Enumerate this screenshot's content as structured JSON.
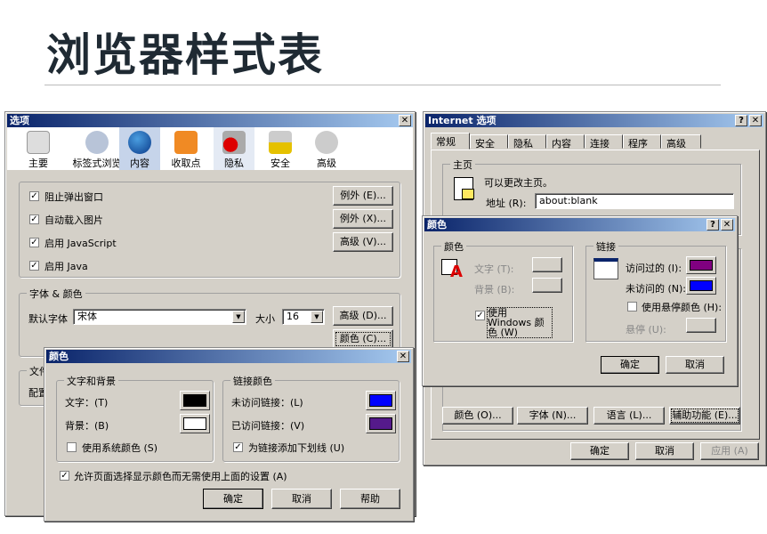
{
  "slide_title": "浏览器样式表",
  "firefox": {
    "title": "选项",
    "toolbar": [
      {
        "label": "主要",
        "icon": "sliders-icon"
      },
      {
        "label": "标签式浏览",
        "icon": "tabs-gear-icon"
      },
      {
        "label": "内容",
        "icon": "globe-icon"
      },
      {
        "label": "收取点",
        "icon": "rss-icon"
      },
      {
        "label": "隐私",
        "icon": "privacy-lock-icon"
      },
      {
        "label": "安全",
        "icon": "padlock-icon"
      },
      {
        "label": "高级",
        "icon": "gear-icon"
      }
    ],
    "selected_tab": "内容",
    "checks": [
      {
        "label": "阻止弹出窗口",
        "checked": true
      },
      {
        "label": "自动载入图片",
        "checked": true
      },
      {
        "label": "启用 JavaScript",
        "checked": true
      },
      {
        "label": "启用 Java",
        "checked": true
      }
    ],
    "side_buttons": [
      "例外 (E)...",
      "例外 (X)...",
      "高级 (V)..."
    ],
    "fonts_group": {
      "legend": "字体 & 颜色",
      "default_font_label": "默认字体",
      "default_font": "宋体",
      "size_label": "大小",
      "size": "16",
      "advanced": "高级 (D)...",
      "colors": "颜色 (C)..."
    },
    "files_group": {
      "legend": "文件",
      "config_label": "配置"
    },
    "colors_dialog": {
      "title": "颜色",
      "text_bg": {
        "legend": "文字和背景",
        "text_label": "文字：(T)",
        "text_color": "#000000",
        "bg_label": "背景：(B)",
        "bg_color": "#ffffff",
        "system_colors": "使用系统颜色 (S)",
        "system_checked": false
      },
      "links": {
        "legend": "链接颜色",
        "unvisited_label": "未访问链接：(L)",
        "unvisited_color": "#0000ff",
        "visited_label": "已访问链接：(V)",
        "visited_color": "#551a8b",
        "underline": "为链接添加下划线 (U)",
        "underline_checked": true
      },
      "allow_page": "允许页面选择显示颜色而无需使用上面的设置 (A)",
      "allow_checked": true,
      "ok": "确定",
      "cancel": "取消",
      "help": "帮助"
    }
  },
  "ie": {
    "title": "Internet 选项",
    "tabs": [
      "常规",
      "安全",
      "隐私",
      "内容",
      "连接",
      "程序",
      "高级"
    ],
    "selected_tab": "常规",
    "home": {
      "legend": "主页",
      "desc": "可以更改主页。",
      "address_label": "地址 (R):",
      "address": "about:blank"
    },
    "bottom_buttons": [
      "颜色 (O)...",
      "字体 (N)...",
      "语言 (L)...",
      "辅助功能 (E)..."
    ],
    "ok": "确定",
    "cancel": "取消",
    "apply": "应用 (A)",
    "colors_dialog": {
      "title": "颜色",
      "colors": {
        "legend": "颜色",
        "text_label": "文字 (T):",
        "bg_label": "背景 (B):",
        "use_windows": "使用 Windows 颜色 (W)",
        "use_windows_checked": true
      },
      "links": {
        "legend": "链接",
        "visited_label": "访问过的 (I):",
        "visited_color": "#800080",
        "unvisited_label": "未访问的 (N):",
        "unvisited_color": "#0000ff",
        "hover_check": "使用悬停颜色 (H):",
        "hover_checked": false,
        "hover_label": "悬停 (U):"
      },
      "ok": "确定",
      "cancel": "取消"
    }
  }
}
